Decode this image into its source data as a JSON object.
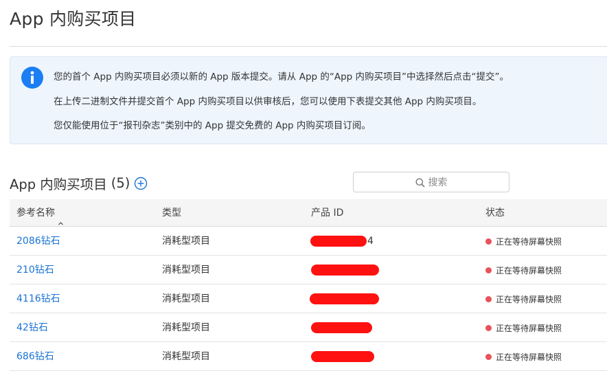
{
  "page": {
    "title": "App 内购买项目"
  },
  "info": {
    "lines": [
      "您的首个 App 内购买项目必须以新的 App 版本提交。请从 App 的“App 内购买项目”中选择然后点击“提交”。",
      "在上传二进制文件并提交首个 App 内购买项目以供审核后，您可以使用下表提交其他 App 内购买项目。",
      "您仅能使用位于“报刊杂志”类别中的 App 提交免费的 App 内购买项目订阅。"
    ]
  },
  "section": {
    "title": "App 内购买项目",
    "count": "(5)"
  },
  "search": {
    "placeholder": "搜索"
  },
  "table": {
    "headers": {
      "name": "参考名称",
      "type": "类型",
      "id": "产品 ID",
      "status": "状态"
    },
    "rows": [
      {
        "name": "2086钻石",
        "type": "消耗型项目",
        "id_tail": "4",
        "status": "正在等待屏幕快照"
      },
      {
        "name": "210钻石",
        "type": "消耗型项目",
        "id_tail": "",
        "status": "正在等待屏幕快照"
      },
      {
        "name": "4116钻石",
        "type": "消耗型项目",
        "id_tail": "",
        "status": "正在等待屏幕快照"
      },
      {
        "name": "42钻石",
        "type": "消耗型项目",
        "id_tail": "",
        "status": "正在等待屏幕快照"
      },
      {
        "name": "686钻石",
        "type": "消耗型项目",
        "id_tail": "",
        "status": "正在等待屏幕快照"
      }
    ]
  },
  "colors": {
    "link": "#1a73d4",
    "info_icon": "#1b7ff3",
    "status_dot": "#e8525a",
    "redaction": "#ff1111"
  }
}
